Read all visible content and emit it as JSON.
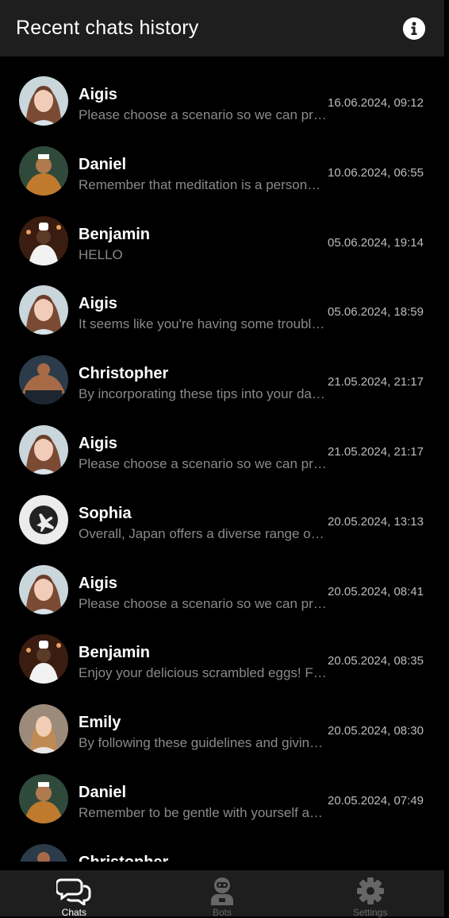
{
  "header": {
    "title": "Recent chats history",
    "info_icon": "info-icon"
  },
  "chats": [
    {
      "name": "Aigis",
      "preview": "Please choose a scenario so we can proceed with our conversation.",
      "date": "16.06.2024, 09:12",
      "avatar": "aigis"
    },
    {
      "name": "Daniel",
      "preview": "Remember that meditation is a personal practice and there is no right way.",
      "date": "10.06.2024, 06:55",
      "avatar": "daniel"
    },
    {
      "name": "Benjamin",
      "preview": "HELLO",
      "date": "05.06.2024, 19:14",
      "avatar": "benjamin"
    },
    {
      "name": "Aigis",
      "preview": "It seems like you're having some trouble with the scenario.",
      "date": "05.06.2024, 18:59",
      "avatar": "aigis"
    },
    {
      "name": "Christopher",
      "preview": "By incorporating these tips into your daily routine you will see results.",
      "date": "21.05.2024, 21:17",
      "avatar": "christopher"
    },
    {
      "name": "Aigis",
      "preview": "Please choose a scenario so we can proceed with our conversation.",
      "date": "21.05.2024, 21:17",
      "avatar": "aigis"
    },
    {
      "name": "Sophia",
      "preview": "Overall, Japan offers a diverse range of experiences for travelers.",
      "date": "20.05.2024, 13:13",
      "avatar": "sophia"
    },
    {
      "name": "Aigis",
      "preview": "Please choose a scenario so we can proceed with our conversation.",
      "date": "20.05.2024, 08:41",
      "avatar": "aigis"
    },
    {
      "name": "Benjamin",
      "preview": "Enjoy your delicious scrambled eggs! Feel free to ask for more recipes.",
      "date": "20.05.2024, 08:35",
      "avatar": "benjamin"
    },
    {
      "name": "Emily",
      "preview": "By following these guidelines and giving yourself time, you will improve.",
      "date": "20.05.2024, 08:30",
      "avatar": "emily"
    },
    {
      "name": "Daniel",
      "preview": "Remember to be gentle with yourself and take it one day at a time.",
      "date": "20.05.2024, 07:49",
      "avatar": "daniel"
    },
    {
      "name": "Christopher",
      "preview": "",
      "date": "",
      "avatar": "christopher"
    }
  ],
  "tabs": [
    {
      "label": "Chats",
      "icon": "chats-icon",
      "active": true
    },
    {
      "label": "Bots",
      "icon": "bots-icon",
      "active": false
    },
    {
      "label": "Settings",
      "icon": "settings-icon",
      "active": false
    }
  ],
  "colors": {
    "background": "#000000",
    "header": "#1e1e1e",
    "preview_text": "#8a8a8a",
    "date_text": "#bdbdbd"
  }
}
